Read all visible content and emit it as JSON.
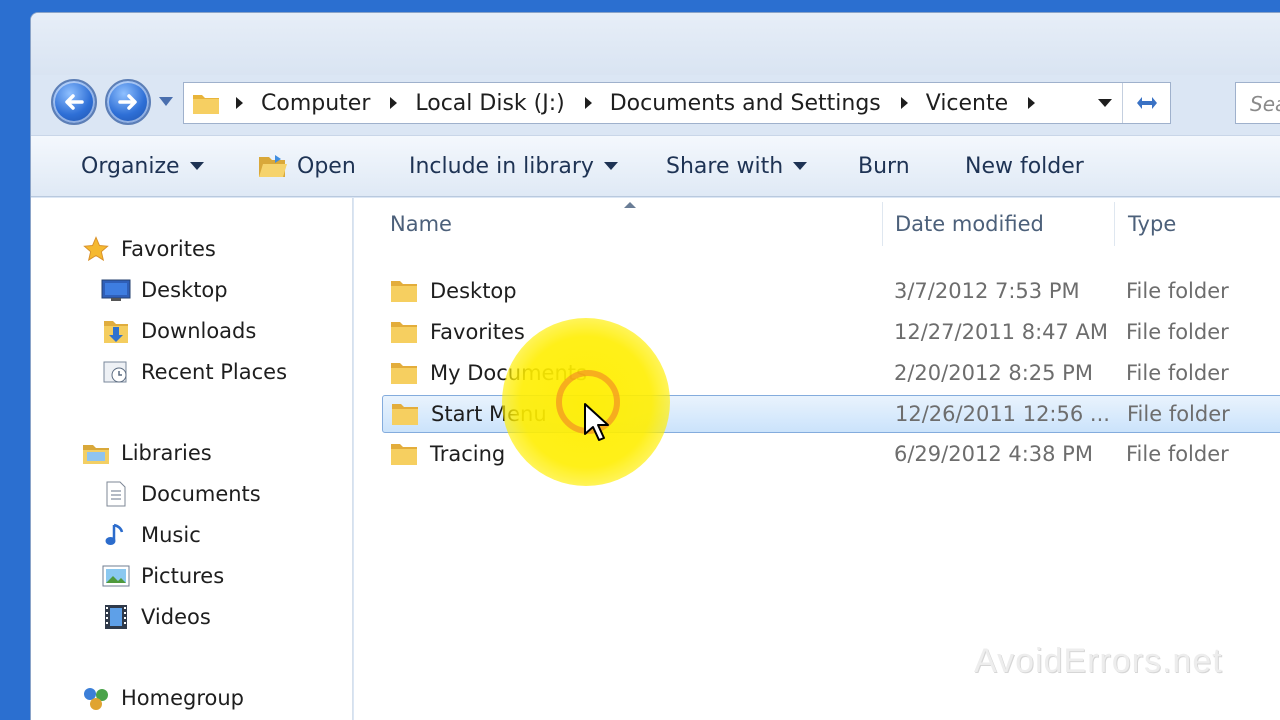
{
  "address": {
    "crumbs": [
      "Computer",
      "Local Disk (J:)",
      "Documents and Settings",
      "Vicente"
    ]
  },
  "search": {
    "placeholder": "Sea"
  },
  "toolbar": {
    "organize": "Organize",
    "open": "Open",
    "include_in_library": "Include in library",
    "share_with": "Share with",
    "burn": "Burn",
    "new_folder": "New folder"
  },
  "nav_pane": {
    "favorites": {
      "label": "Favorites",
      "items": [
        "Desktop",
        "Downloads",
        "Recent Places"
      ]
    },
    "libraries": {
      "label": "Libraries",
      "items": [
        "Documents",
        "Music",
        "Pictures",
        "Videos"
      ]
    },
    "homegroup": "Homegroup"
  },
  "columns": {
    "name": "Name",
    "date_modified": "Date modified",
    "type": "Type"
  },
  "files": [
    {
      "name": "Desktop",
      "date": "3/7/2012 7:53 PM",
      "type": "File folder"
    },
    {
      "name": "Favorites",
      "date": "12/27/2011 8:47 AM",
      "type": "File folder"
    },
    {
      "name": "My Documents",
      "date": "2/20/2012 8:25 PM",
      "type": "File folder"
    },
    {
      "name": "Start Menu",
      "date": "12/26/2011 12:56 ...",
      "type": "File folder"
    },
    {
      "name": "Tracing",
      "date": "6/29/2012 4:38 PM",
      "type": "File folder"
    }
  ],
  "selected_file": "Start Menu",
  "watermark": "AvoidErrors.net",
  "colors": {
    "folder": "#f2c24f",
    "selection": "#cbe3fb",
    "highlight": "#ffee00"
  }
}
